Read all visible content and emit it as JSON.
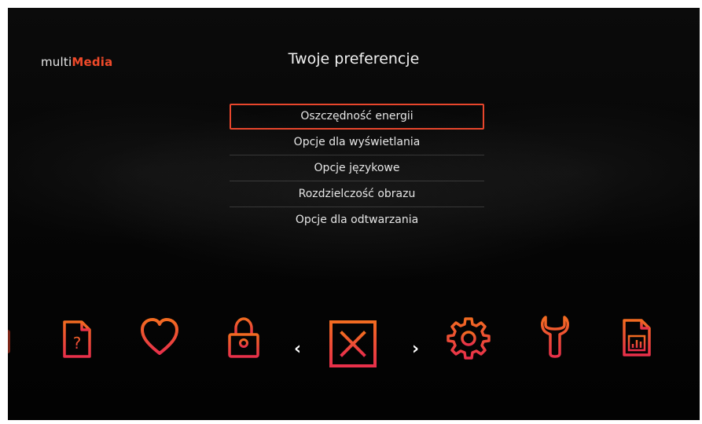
{
  "brand": {
    "prefix": "multi",
    "accent": "Media",
    "accent_color": "#f04a2a"
  },
  "header": {
    "title": "Twoje preferencje"
  },
  "menu": {
    "items": [
      {
        "label": "Oszczędność energii",
        "selected": true
      },
      {
        "label": "Opcje dla wyświetlania",
        "selected": false
      },
      {
        "label": "Opcje językowe",
        "selected": false
      },
      {
        "label": "Rozdzielczość obrazu",
        "selected": false
      },
      {
        "label": "Opcje dla odtwarzania",
        "selected": false
      }
    ],
    "highlight_color": "#e8462c"
  },
  "carousel": {
    "icons": [
      "help-document-icon",
      "heart-icon",
      "padlock-icon",
      "close-box-icon",
      "gear-icon",
      "wrench-icon",
      "chart-document-icon"
    ],
    "selected_icon": "close-box-icon",
    "prev_arrow": "‹",
    "next_arrow": "›",
    "icon_gradient": [
      "#f26b21",
      "#e8304a"
    ]
  }
}
